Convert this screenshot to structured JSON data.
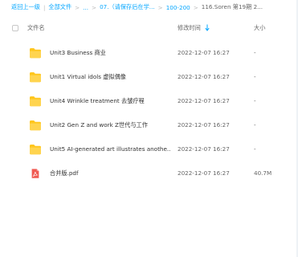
{
  "breadcrumb": {
    "items": [
      "返回上一级",
      "全部文件",
      "...",
      "07.（请保存后在学...",
      "100-200",
      "116.Soren 第19期 2..."
    ],
    "separator": "|"
  },
  "table": {
    "header": {
      "name": "文件名",
      "date": "修改时间",
      "size": "大小"
    },
    "rows": [
      {
        "icon": "folder-icon",
        "name": "Unit3 Business 商业",
        "date": "2022-12-07 16:27",
        "size": "-"
      },
      {
        "icon": "folder-icon",
        "name": "Unit1 Virtual idols 虚拟偶像",
        "date": "2022-12-07 16:27",
        "size": "-"
      },
      {
        "icon": "folder-icon",
        "name": "Unit4 Wrinkle treatment 去皱疗程",
        "date": "2022-12-07 16:27",
        "size": "-"
      },
      {
        "icon": "folder-icon",
        "name": "Unit2 Gen Z and work Z世代与工作",
        "date": "2022-12-07 16:27",
        "size": "-"
      },
      {
        "icon": "folder-icon",
        "name": "Unit5 AI-generated art illustrates anothe...",
        "date": "2022-12-07 16:27",
        "size": "-"
      },
      {
        "icon": "pdf-icon",
        "name": "合并版.pdf",
        "date": "2022-12-07 16:27",
        "size": "40.7M"
      }
    ]
  },
  "colors": {
    "link": "#06a7ff",
    "folder": "#ffc61d",
    "pdf": "#f05a52",
    "sort": "#06a7ff"
  }
}
